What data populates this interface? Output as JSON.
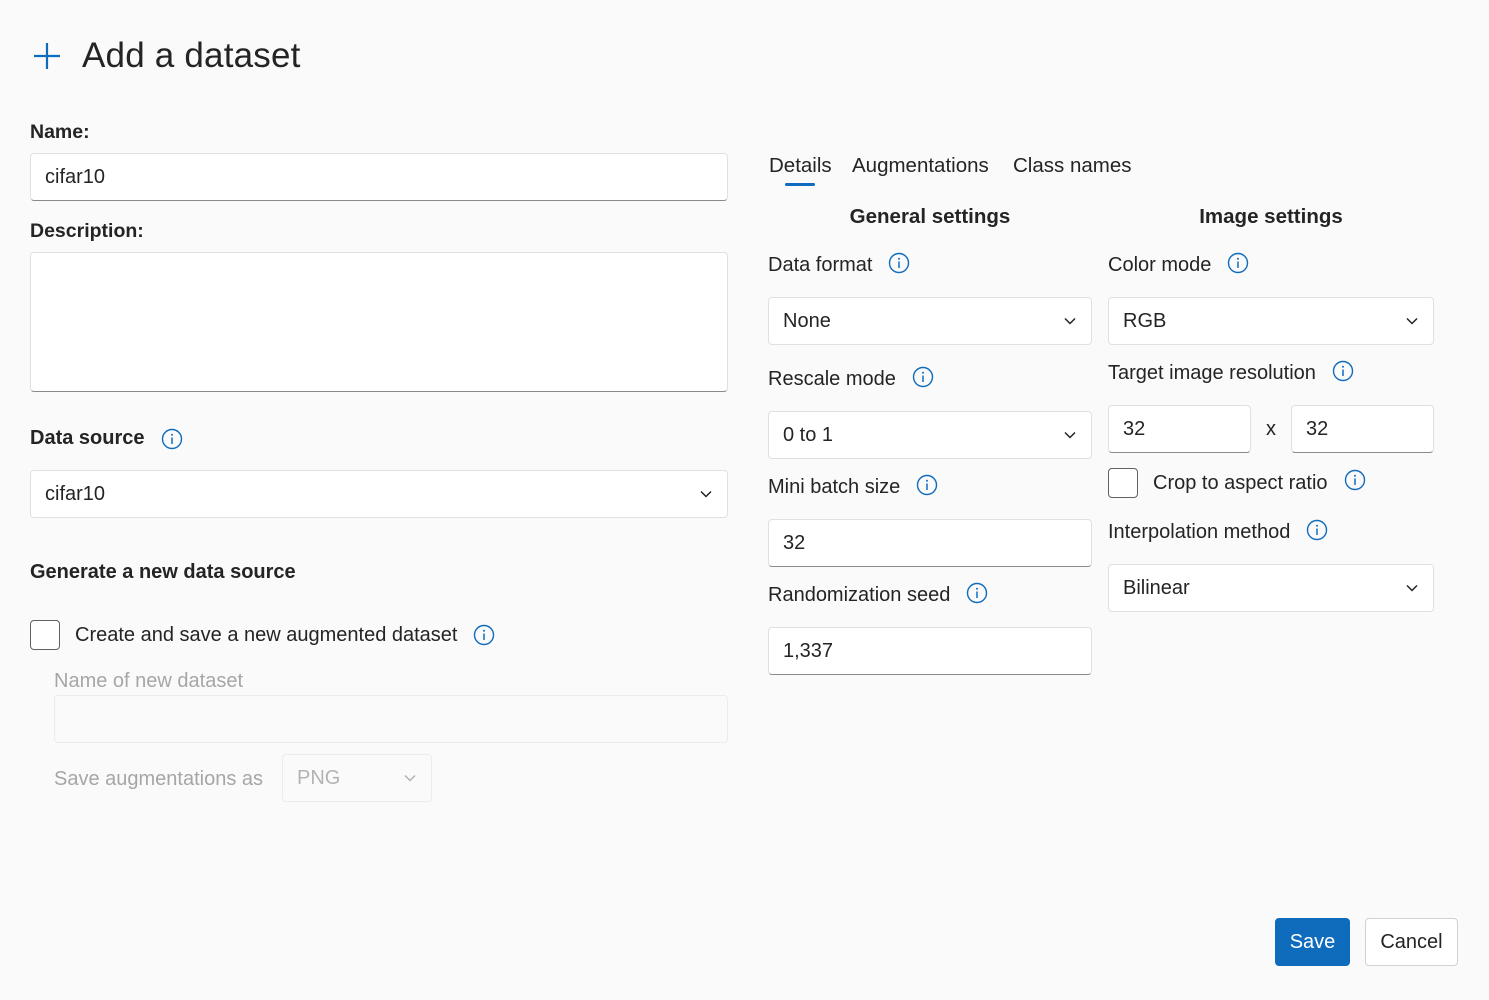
{
  "page": {
    "title": "Add a dataset",
    "accent_color": "#0f6cbd"
  },
  "left": {
    "name_label": "Name:",
    "name_value": "cifar10",
    "description_label": "Description:",
    "description_value": "",
    "data_source_label": "Data source",
    "data_source_value": "cifar10",
    "generate_heading": "Generate a new data source",
    "create_checkbox_label": "Create and save a new augmented dataset",
    "create_checkbox_checked": false,
    "new_dataset_label": "Name of new dataset",
    "new_dataset_value": "",
    "save_as_label": "Save augmentations as",
    "save_as_value": "PNG"
  },
  "tabs": [
    {
      "label": "Details",
      "active": true
    },
    {
      "label": "Augmentations",
      "active": false
    },
    {
      "label": "Class names",
      "active": false
    }
  ],
  "general": {
    "heading": "General settings",
    "data_format_label": "Data format",
    "data_format_value": "None",
    "rescale_label": "Rescale mode",
    "rescale_value": "0 to 1",
    "batch_label": "Mini batch size",
    "batch_value": "32",
    "seed_label": "Randomization seed",
    "seed_value": "1,337"
  },
  "image": {
    "heading": "Image settings",
    "color_mode_label": "Color mode",
    "color_mode_value": "RGB",
    "resolution_label": "Target image resolution",
    "res_width": "32",
    "res_separator": "x",
    "res_height": "32",
    "crop_label": "Crop to aspect ratio",
    "crop_checked": false,
    "interp_label": "Interpolation method",
    "interp_value": "Bilinear"
  },
  "footer": {
    "save_label": "Save",
    "cancel_label": "Cancel"
  },
  "icons": {
    "add": "plus-icon",
    "info": "info-icon",
    "dropdown": "chevron-down-icon"
  }
}
